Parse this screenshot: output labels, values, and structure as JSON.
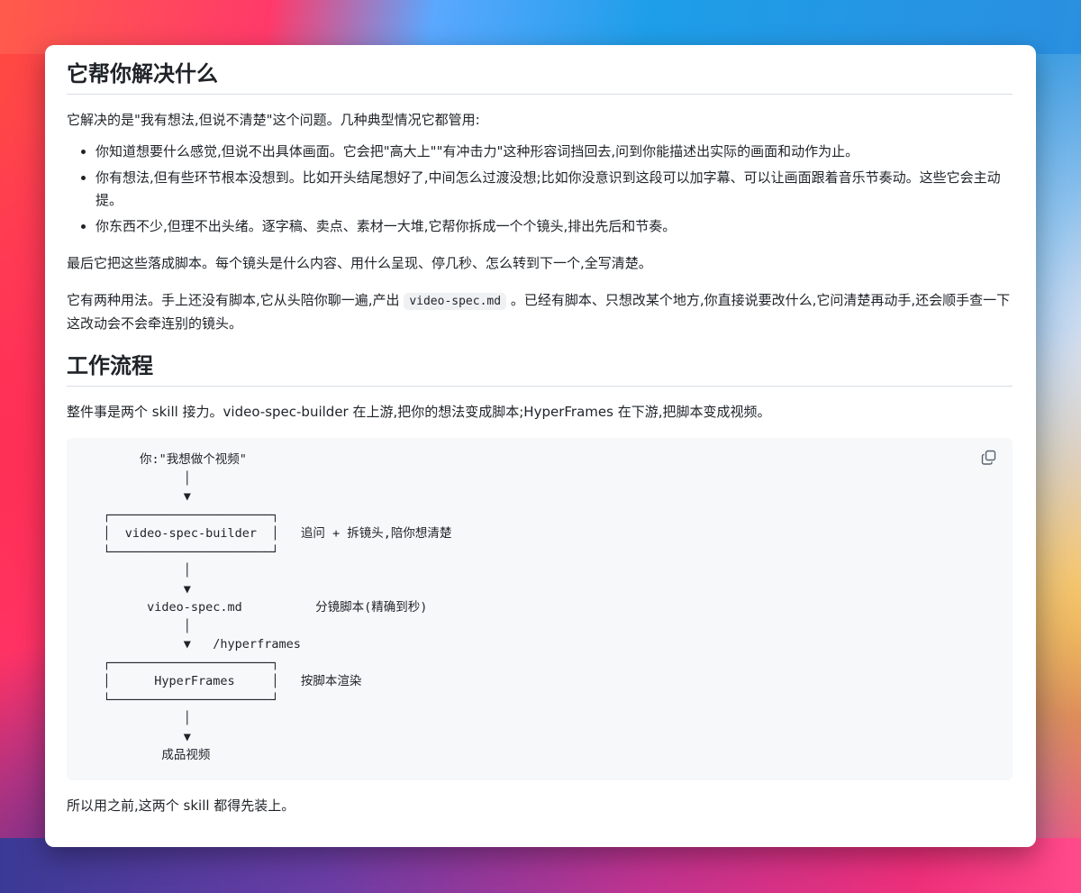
{
  "section1": {
    "heading": "它帮你解决什么",
    "intro": "它解决的是\"我有想法,但说不清楚\"这个问题。几种典型情况它都管用:",
    "bullets": [
      "你知道想要什么感觉,但说不出具体画面。它会把\"高大上\"\"有冲击力\"这种形容词挡回去,问到你能描述出实际的画面和动作为止。",
      "你有想法,但有些环节根本没想到。比如开头结尾想好了,中间怎么过渡没想;比如你没意识到这段可以加字幕、可以让画面跟着音乐节奏动。这些它会主动提。",
      "你东西不少,但理不出头绪。逐字稿、卖点、素材一大堆,它帮你拆成一个个镜头,排出先后和节奏。"
    ],
    "para2": "最后它把这些落成脚本。每个镜头是什么内容、用什么呈现、停几秒、怎么转到下一个,全写清楚。",
    "para3_before": "它有两种用法。手上还没有脚本,它从头陪你聊一遍,产出 ",
    "para3_code": "video-spec.md",
    "para3_after": " 。已经有脚本、只想改某个地方,你直接说要改什么,它问清楚再动手,还会顺手查一下这改动会不会牵连别的镜头。"
  },
  "section2": {
    "heading": "工作流程",
    "intro": "整件事是两个 skill 接力。video-spec-builder 在上游,把你的想法变成脚本;HyperFrames 在下游,把脚本变成视频。",
    "flow_diagram": "        你:\"我想做个视频\"\n              │\n              ▼\n   ┌──────────────────────┐\n   │  video-spec-builder  │   追问 + 拆镜头,陪你想清楚\n   └──────────────────────┘\n              │\n              ▼\n         video-spec.md          分镜脚本(精确到秒)\n              │\n              ▼   /hyperframes\n   ┌──────────────────────┐\n   │      HyperFrames     │   按脚本渲染\n   └──────────────────────┘\n              │\n              ▼\n           成品视频",
    "outro": "所以用之前,这两个 skill 都得先装上。"
  }
}
